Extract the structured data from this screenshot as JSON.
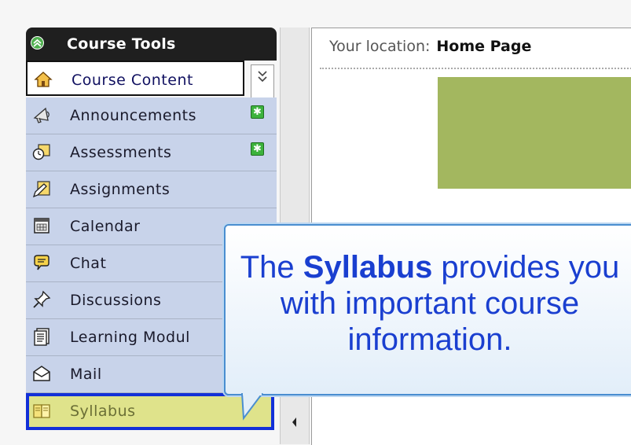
{
  "tools": {
    "title": "Course Tools",
    "items": [
      {
        "label": "Course Content",
        "icon": "home-icon"
      },
      {
        "label": "Announcements",
        "icon": "megaphone-icon",
        "new": true
      },
      {
        "label": "Assessments",
        "icon": "stopwatch-icon",
        "new": true
      },
      {
        "label": "Assignments",
        "icon": "pencil-paper-icon"
      },
      {
        "label": "Calendar",
        "icon": "calendar-icon"
      },
      {
        "label": "Chat",
        "icon": "speech-bubble-icon"
      },
      {
        "label": "Discussions",
        "icon": "pushpin-icon"
      },
      {
        "label": "Learning Modul",
        "icon": "document-icon"
      },
      {
        "label": "Mail",
        "icon": "envelope-icon"
      },
      {
        "label": "Syllabus",
        "icon": "book-icon"
      }
    ],
    "new_badge": "✱"
  },
  "location": {
    "prefix": "Your location:",
    "page": "Home Page"
  },
  "callout": {
    "pre": "The ",
    "bold": "Syllabus",
    "post": " provides you with important course information."
  },
  "colors": {
    "header_bg": "#1f1f1f",
    "row_bg": "#c8d3ea",
    "selected_bg": "#dfe38b",
    "selected_border": "#1230d8",
    "banner": "#a3b75f",
    "callout_text": "#1a3fd0"
  }
}
